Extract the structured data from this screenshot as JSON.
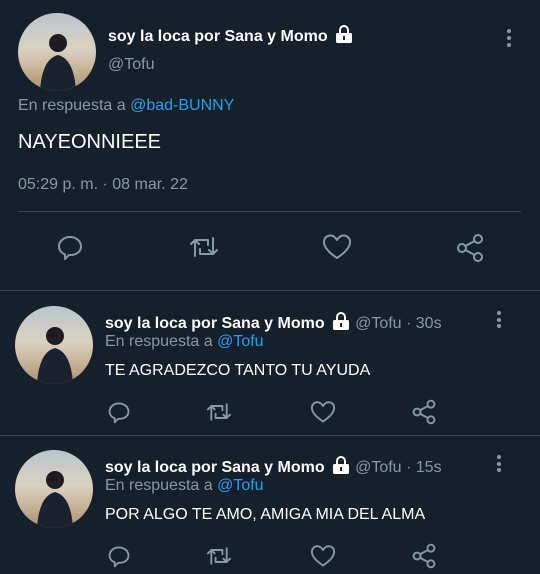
{
  "main_tweet": {
    "display_name": "soy la loca por Sana y Momo",
    "handle": "@Tofu",
    "reply_prefix": "En respuesta a",
    "reply_to": "@bad-BUNNY",
    "text": "NAYEONNIEEE",
    "timestamp": "05:29 p. m. · 08 mar. 22"
  },
  "replies": [
    {
      "display_name": "soy la loca por Sana y Momo",
      "handle_time": "@Tofu · 30s",
      "reply_prefix": "En respuesta a",
      "reply_to": "@Tofu",
      "text": "TE AGRADEZCO TANTO TU AYUDA"
    },
    {
      "display_name": "soy la loca por Sana y Momo",
      "handle_time": "@Tofu · 15s",
      "reply_prefix": "En respuesta a",
      "reply_to": "@Tofu",
      "text": "POR ALGO TE AMO, AMIGA MIA DEL ALMA"
    }
  ],
  "icons": [
    "lock-icon",
    "reply-icon",
    "retweet-icon",
    "like-icon",
    "share-icon",
    "more-icon"
  ],
  "colors": {
    "background": "#15202b",
    "muted": "#8899a6",
    "link": "#1da1f2",
    "divider": "#38444d"
  }
}
